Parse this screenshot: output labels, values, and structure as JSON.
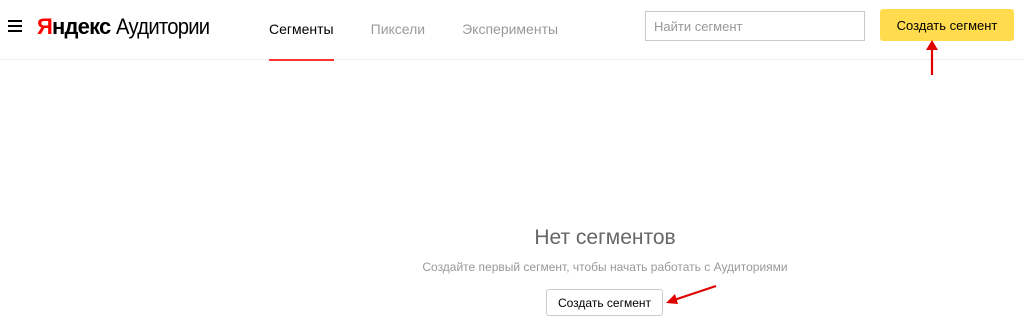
{
  "header": {
    "logo_brand_first": "Я",
    "logo_brand_rest": "ндекс",
    "logo_service": "Аудитории",
    "tabs": [
      {
        "label": "Сегменты",
        "active": true
      },
      {
        "label": "Пиксели",
        "active": false
      },
      {
        "label": "Эксперименты",
        "active": false
      }
    ],
    "search_placeholder": "Найти сегмент",
    "create_button_label": "Создать сегмент"
  },
  "empty_state": {
    "title": "Нет сегментов",
    "subtitle": "Создайте первый сегмент, чтобы начать работать с Аудиториями",
    "create_button_label": "Создать сегмент"
  },
  "icons": {
    "menu": "menu-icon"
  },
  "colors": {
    "accent_yellow": "#ffdb4d",
    "active_tab_underline": "#ff3333",
    "logo_red": "#ff0000",
    "annotation_arrow": "#e00000"
  }
}
